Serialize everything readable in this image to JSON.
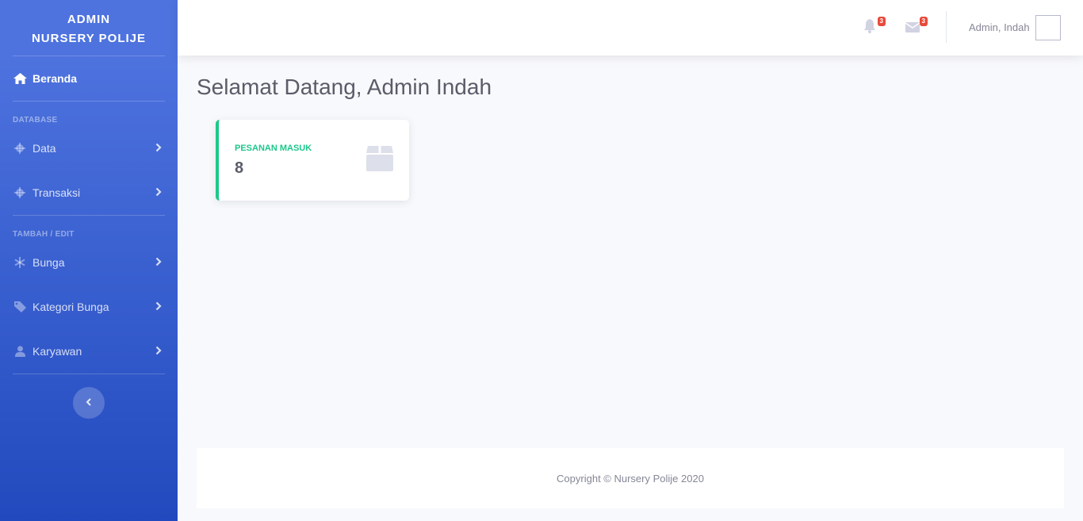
{
  "brand": {
    "line1": "ADMIN",
    "line2": "NURSERY POLIJE"
  },
  "sidebar": {
    "home": {
      "label": "Beranda",
      "icon": "home-icon"
    },
    "heading1": "DATABASE",
    "section1": [
      {
        "label": "Data",
        "icon": "gear-icon"
      },
      {
        "label": "Transaksi",
        "icon": "gear-icon"
      }
    ],
    "heading2": "TAMBAH / EDIT",
    "section2": [
      {
        "label": "Bunga",
        "icon": "snowflake-icon"
      },
      {
        "label": "Kategori Bunga",
        "icon": "tag-icon"
      },
      {
        "label": "Karyawan",
        "icon": "user-icon"
      }
    ]
  },
  "topbar": {
    "alerts_count": "3",
    "messages_count": "3",
    "user_name": "Admin, Indah"
  },
  "main": {
    "title": "Selamat Datang, Admin Indah",
    "card": {
      "label": "PESANAN MASUK",
      "value": "8",
      "icon": "box-icon",
      "accent": "#1cc88a"
    }
  },
  "footer": {
    "text": "Copyright © Nursery Polije 2020"
  },
  "colors": {
    "primary": "#4e73df",
    "primary_dark": "#224abe",
    "danger": "#e74a3b",
    "success": "#1cc88a"
  }
}
